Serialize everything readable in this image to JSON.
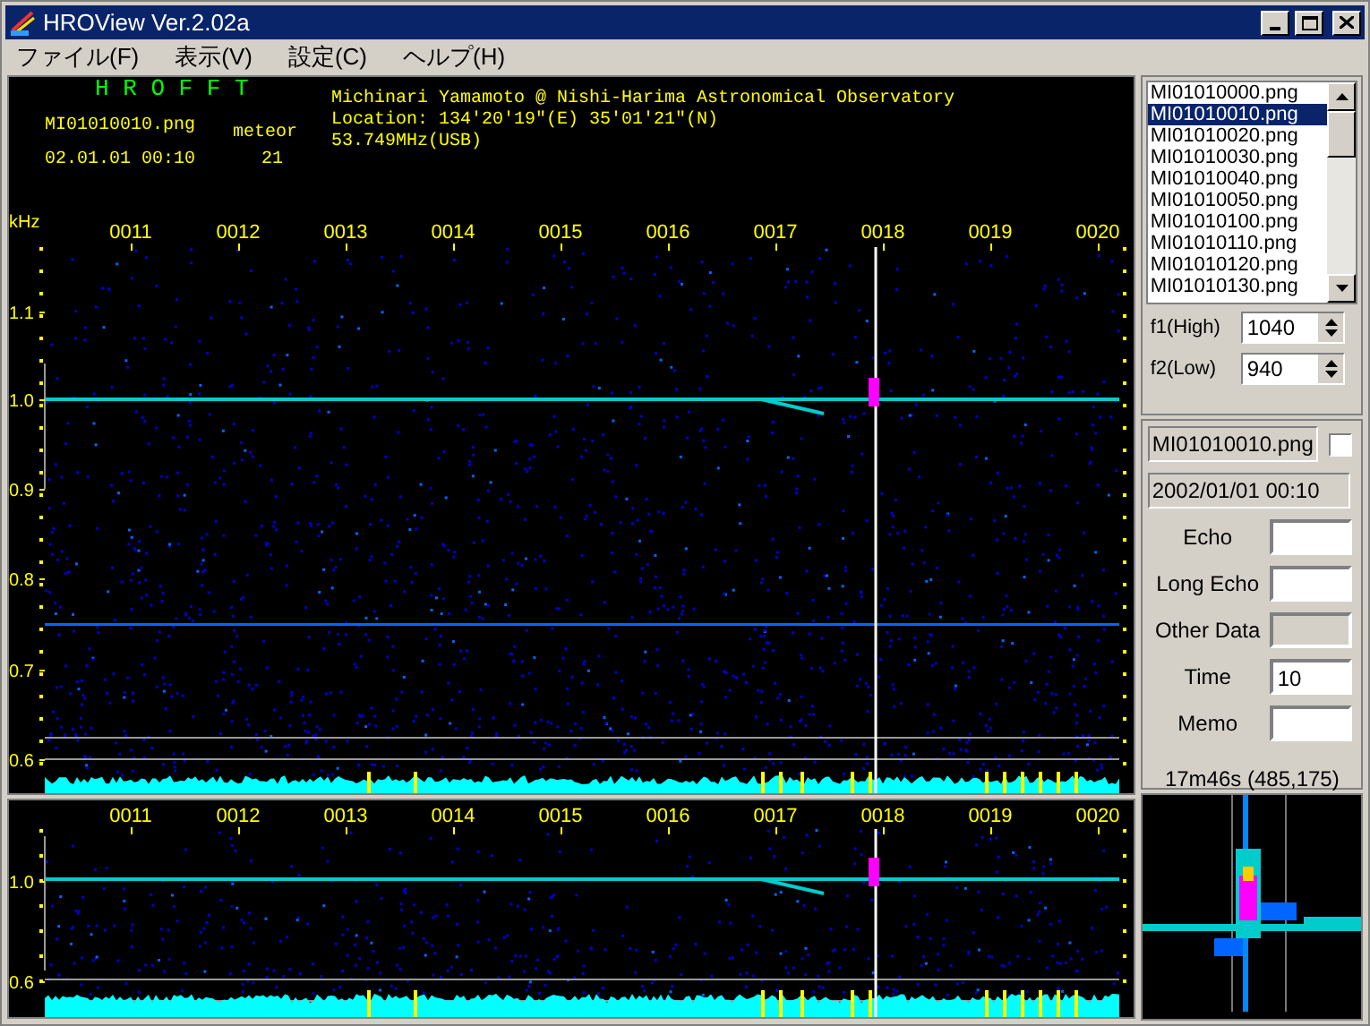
{
  "window": {
    "title": "HROView Ver.2.02a"
  },
  "menu": [
    {
      "label": "ファイル(F)"
    },
    {
      "label": "表示(V)"
    },
    {
      "label": "設定(C)"
    },
    {
      "label": "ヘルプ(H)"
    }
  ],
  "header": {
    "program": "H R O F F T",
    "file": "MI01010010.png",
    "datetime": "02.01.01 00:10",
    "type_label": "meteor",
    "count": "21",
    "observer": "Michinari Yamamoto @ Nishi-Harima Astronomical Observatory",
    "location": "Location: 134'20'19\"(E) 35'01'21\"(N)",
    "frequency": "53.749MHz(USB)"
  },
  "spectrogram": {
    "unit": "kHz",
    "y_labels": [
      "1.1",
      "1.0",
      "0.9",
      "0.8",
      "0.7",
      "0.6"
    ],
    "time_labels": [
      "0011",
      "0012",
      "0013",
      "0014",
      "0015",
      "0016",
      "0017",
      "0018",
      "0019",
      "0020"
    ]
  },
  "detail": {
    "y_labels": [
      "1.0",
      "0.6"
    ],
    "time_labels": [
      "0011",
      "0012",
      "0013",
      "0014",
      "0015",
      "0016",
      "0017",
      "0018",
      "0019",
      "0020"
    ]
  },
  "file_list": [
    {
      "label": "MI01010000.png",
      "selected": false
    },
    {
      "label": "MI01010010.png",
      "selected": true
    },
    {
      "label": "MI01010020.png",
      "selected": false
    },
    {
      "label": "MI01010030.png",
      "selected": false
    },
    {
      "label": "MI01010040.png",
      "selected": false
    },
    {
      "label": "MI01010050.png",
      "selected": false
    },
    {
      "label": "MI01010100.png",
      "selected": false
    },
    {
      "label": "MI01010110.png",
      "selected": false
    },
    {
      "label": "MI01010120.png",
      "selected": false
    },
    {
      "label": "MI01010130.png",
      "selected": false
    }
  ],
  "filter": [
    {
      "label": "f1(High)",
      "value": "1040"
    },
    {
      "label": "f2(Low)",
      "value": "940"
    }
  ],
  "record": {
    "file": "MI01010010.png",
    "checked": false,
    "datetime": "2002/01/01 00:10",
    "fields": [
      {
        "label": "Echo",
        "disabled": false
      },
      {
        "label": "Long Echo",
        "disabled": false
      },
      {
        "label": "Other Data",
        "disabled": true
      },
      {
        "label": "Time",
        "value": "10",
        "disabled": false
      },
      {
        "label": "Memo",
        "disabled": false
      }
    ]
  },
  "cursor": "17m46s (485,175)"
}
